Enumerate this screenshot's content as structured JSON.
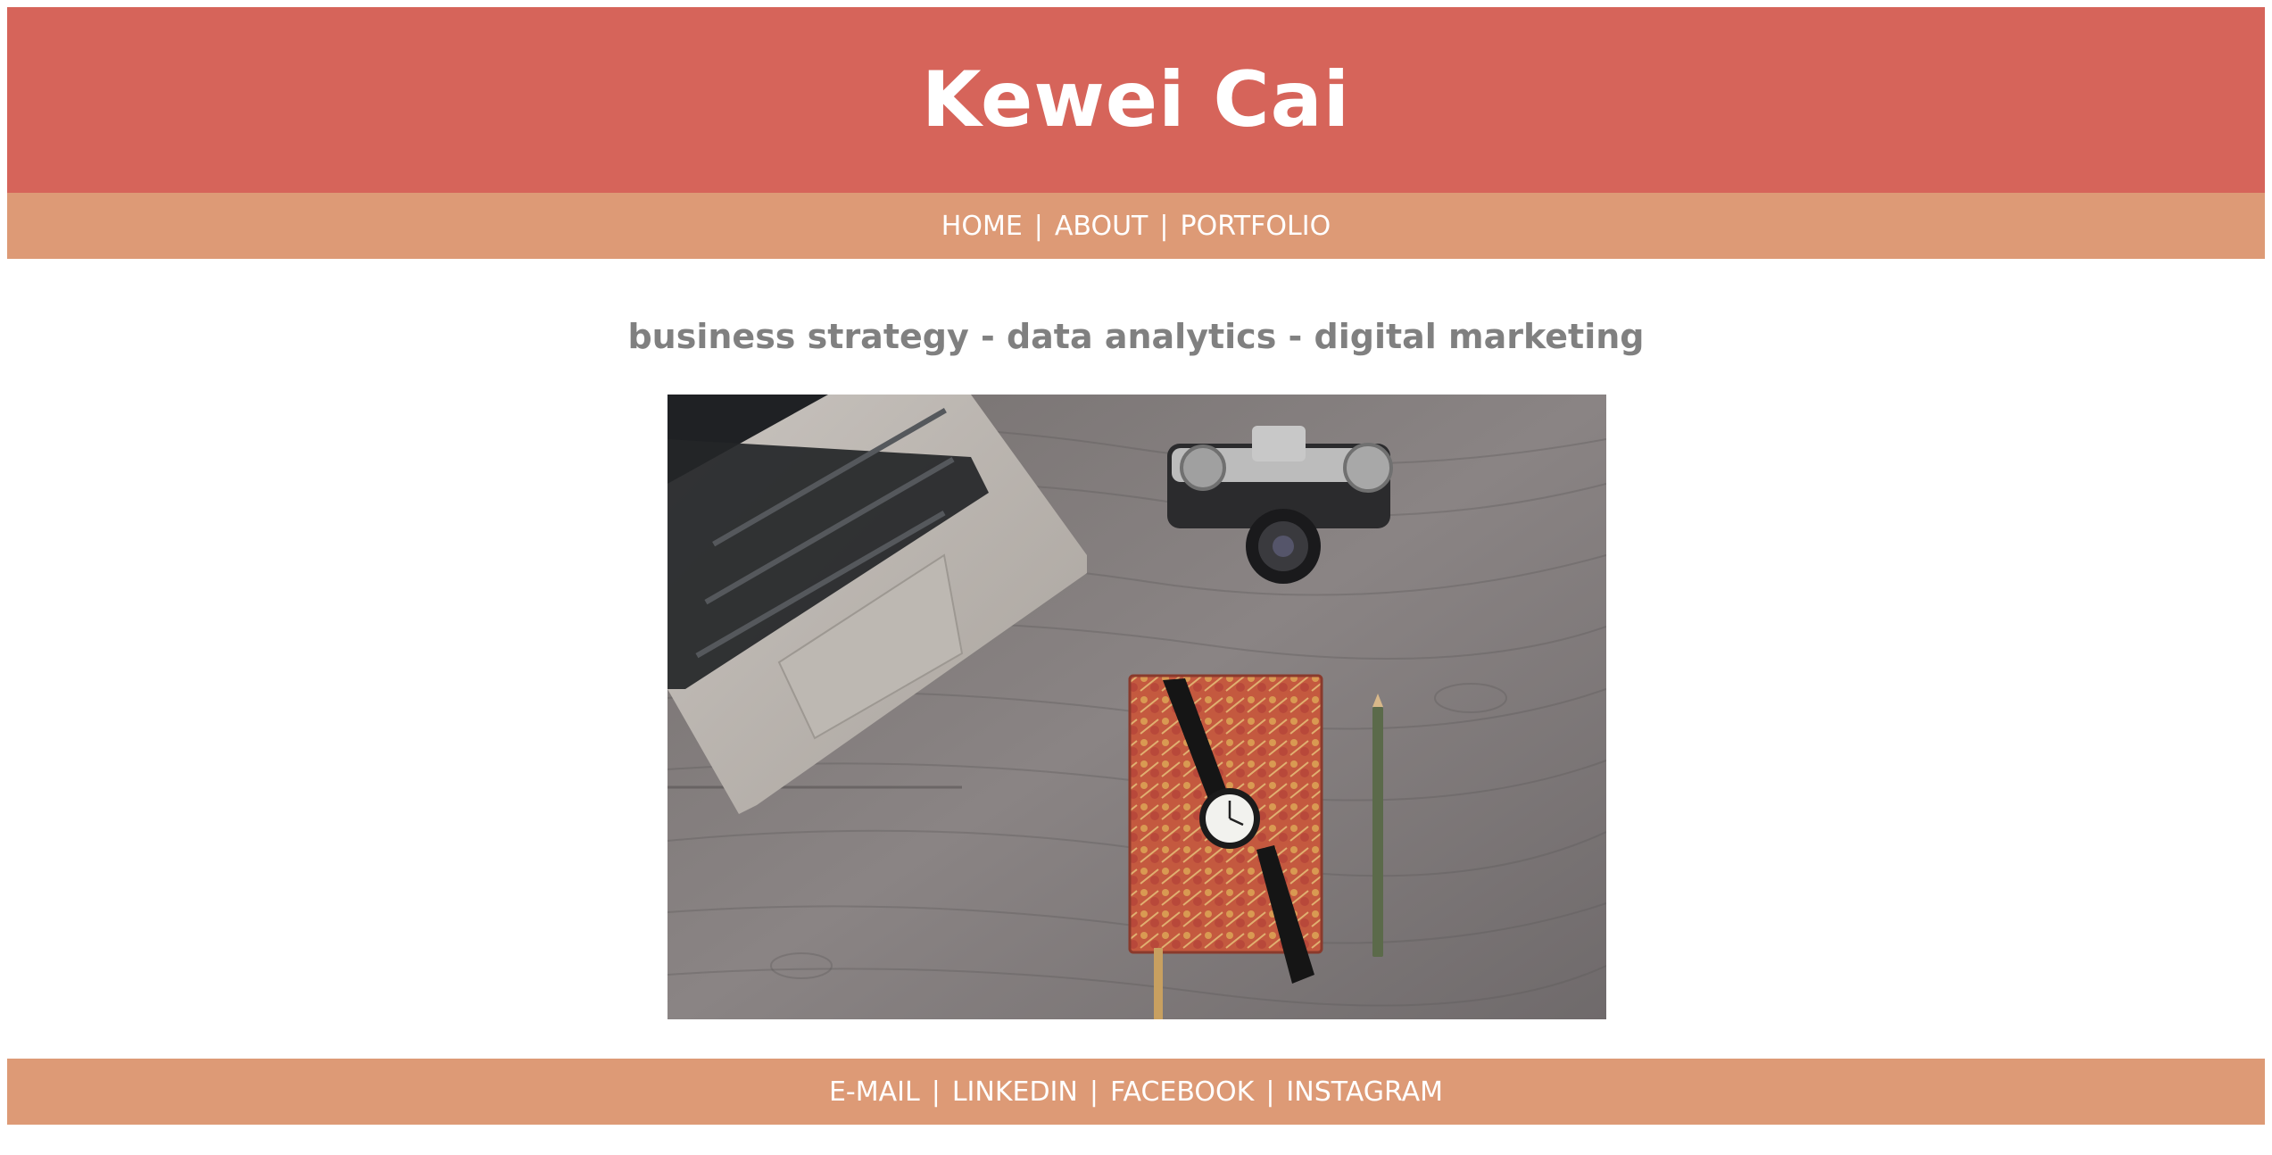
{
  "header": {
    "title": "Kewei Cai"
  },
  "nav": {
    "items": [
      "HOME",
      "ABOUT",
      "PORTFOLIO"
    ],
    "separator": "|"
  },
  "main": {
    "tagline": "business strategy - data analytics - digital marketing",
    "hero_image": {
      "subject": "desk-flatlay-photo",
      "elements": [
        "laptop",
        "camera",
        "notebook",
        "wristwatch",
        "pencil"
      ]
    }
  },
  "footer": {
    "items": [
      "E-MAIL",
      "LINKEDIN",
      "FACEBOOK",
      "INSTAGRAM"
    ],
    "separator": "|"
  },
  "colors": {
    "header_bg": "#d6645a",
    "nav_bg": "#dd9a76",
    "tagline": "#808080",
    "text_light": "#ffffff"
  }
}
